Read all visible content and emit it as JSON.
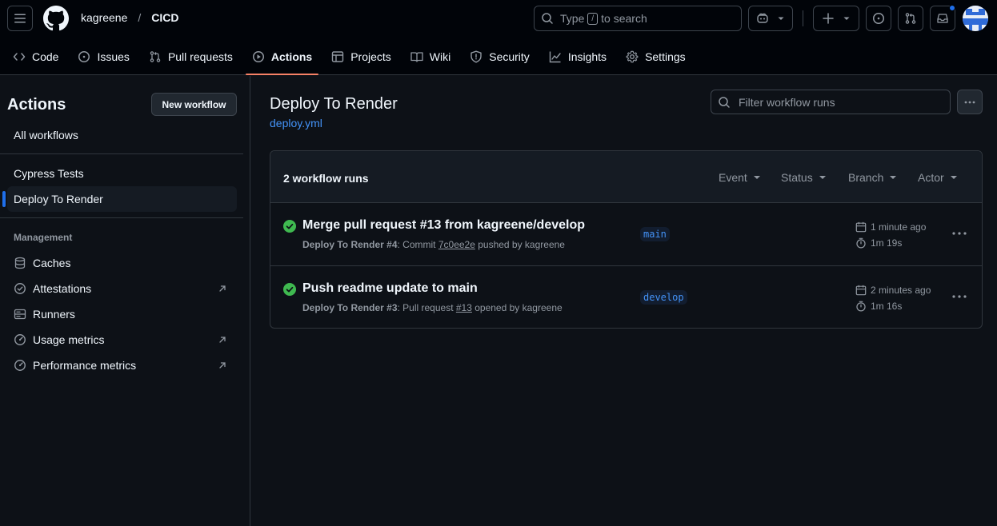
{
  "header": {
    "owner": "kagreene",
    "separator": "/",
    "repo": "CICD",
    "search_prefix": "Type",
    "search_key": "/",
    "search_suffix": "to search"
  },
  "tabs": [
    {
      "label": "Code",
      "icon": "code-icon"
    },
    {
      "label": "Issues",
      "icon": "issue-opened-icon"
    },
    {
      "label": "Pull requests",
      "icon": "git-pull-request-icon"
    },
    {
      "label": "Actions",
      "icon": "play-icon",
      "active": true
    },
    {
      "label": "Projects",
      "icon": "table-icon"
    },
    {
      "label": "Wiki",
      "icon": "book-icon"
    },
    {
      "label": "Security",
      "icon": "shield-icon"
    },
    {
      "label": "Insights",
      "icon": "graph-icon"
    },
    {
      "label": "Settings",
      "icon": "gear-icon"
    }
  ],
  "sidebar": {
    "title": "Actions",
    "new_workflow": "New workflow",
    "all_workflows": "All workflows",
    "workflows": [
      {
        "label": "Cypress Tests"
      },
      {
        "label": "Deploy To Render",
        "selected": true
      }
    ],
    "management_label": "Management",
    "management": [
      {
        "label": "Caches",
        "icon": "database-icon"
      },
      {
        "label": "Attestations",
        "icon": "verified-icon",
        "external": true
      },
      {
        "label": "Runners",
        "icon": "server-icon"
      },
      {
        "label": "Usage metrics",
        "icon": "meter-icon",
        "external": true
      },
      {
        "label": "Performance metrics",
        "icon": "meter-icon",
        "external": true
      }
    ]
  },
  "main": {
    "title": "Deploy To Render",
    "file": "deploy.yml",
    "filter_placeholder": "Filter workflow runs",
    "runs_count": "2 workflow runs",
    "filters": [
      "Event",
      "Status",
      "Branch",
      "Actor"
    ],
    "runs": [
      {
        "title": "Merge pull request #13 from kagreene/develop",
        "workflow": "Deploy To Render",
        "run_number": "#4",
        "meta_prefix": ": Commit ",
        "meta_ref": "7c0ee2e",
        "meta_suffix": " pushed by kagreene",
        "branch": "main",
        "time_ago": "1 minute ago",
        "duration": "1m 19s",
        "status": "success"
      },
      {
        "title": "Push readme update to main",
        "workflow": "Deploy To Render",
        "run_number": "#3",
        "meta_prefix": ": Pull request ",
        "meta_ref": "#13",
        "meta_suffix": " opened by kagreene",
        "branch": "develop",
        "time_ago": "2 minutes ago",
        "duration": "1m 16s",
        "status": "success"
      }
    ]
  },
  "colors": {
    "accent": "#1f6feb",
    "link": "#4493f8",
    "success": "#3fb950",
    "tab_underline": "#f78166"
  }
}
